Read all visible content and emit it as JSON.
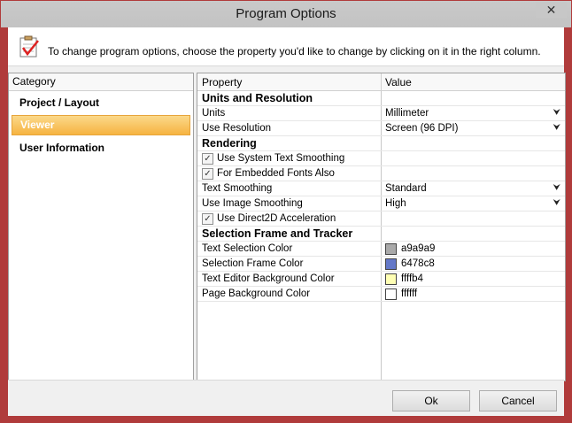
{
  "window": {
    "title": "Program Options",
    "close_glyph": "✕"
  },
  "header": {
    "text": "To change program options, choose the property you'd like to change by clicking on it in the right column.",
    "icon": "checklist-icon"
  },
  "sidebar": {
    "header": "Category",
    "items": [
      {
        "label": "Project / Layout",
        "selected": false
      },
      {
        "label": "Viewer",
        "selected": true
      },
      {
        "label": "User Information",
        "selected": false
      }
    ]
  },
  "grid": {
    "col_property": "Property",
    "col_value": "Value",
    "sections": [
      {
        "title": "Units and Resolution",
        "rows": [
          {
            "label": "Units",
            "value": "Millimeter"
          },
          {
            "label": "Use Resolution",
            "value": "Screen (96 DPI)"
          }
        ]
      },
      {
        "title": "Rendering",
        "rows": [
          {
            "label": "Use System Text Smoothing",
            "checked": true
          },
          {
            "label": "For Embedded Fonts Also",
            "checked": true
          },
          {
            "label": "Text Smoothing",
            "value": "Standard"
          },
          {
            "label": "Use Image Smoothing",
            "value": "High"
          },
          {
            "label": "Use Direct2D Acceleration",
            "checked": true
          }
        ]
      },
      {
        "title": "Selection Frame and Tracker",
        "rows": [
          {
            "label": "Text Selection Color",
            "value": "a9a9a9",
            "color": "#a9a9a9"
          },
          {
            "label": "Selection Frame Color",
            "value": "6478c8",
            "color": "#6478c8"
          },
          {
            "label": "Text Editor Background Color",
            "value": "ffffb4",
            "color": "#ffffb4"
          },
          {
            "label": "Page Background Color",
            "value": "ffffff",
            "color": "#ffffff"
          }
        ]
      }
    ],
    "dropdown_glyph": "⮟"
  },
  "buttons": {
    "ok": "Ok",
    "cancel": "Cancel"
  },
  "colors": {
    "window_border": "#b03b3b",
    "selection_orange": "#f6b341"
  }
}
